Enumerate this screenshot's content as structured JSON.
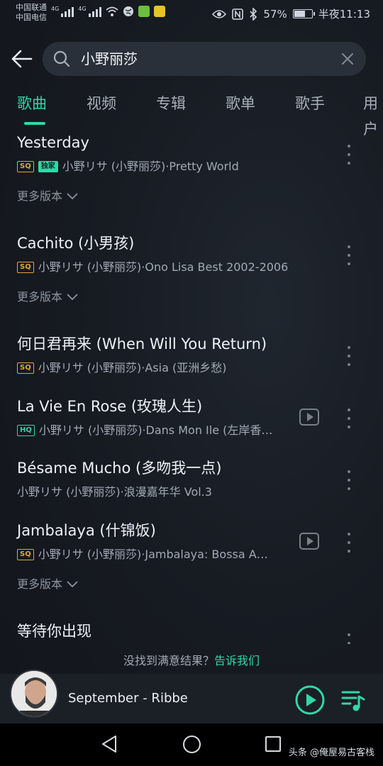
{
  "status_bar": {
    "carrier_1": "中国联通",
    "carrier_2": "中国电信",
    "net_1": "4G",
    "net_2": "4G",
    "battery": "57%",
    "battery_level": 0.57,
    "time": "半夜11:13"
  },
  "search": {
    "query": "小野丽莎"
  },
  "tabs": [
    {
      "label": "歌曲",
      "active": true
    },
    {
      "label": "视频"
    },
    {
      "label": "专辑"
    },
    {
      "label": "歌单"
    },
    {
      "label": "歌手"
    },
    {
      "label": "用户"
    }
  ],
  "songs": [
    {
      "title": "Yesterday",
      "badges": [
        "SQ",
        "独家"
      ],
      "meta": "小野リサ (小野丽莎)·Pretty World",
      "more_versions": "更多版本"
    },
    {
      "title": "Cachito (小男孩)",
      "badges": [
        "SQ"
      ],
      "meta": "小野リサ (小野丽莎)·Ono Lisa Best 2002-2006",
      "more_versions": "更多版本"
    },
    {
      "title": "何日君再来 (When Will You Return)",
      "badges": [
        "SQ"
      ],
      "meta": "小野リサ (小野丽莎)·Asia (亚洲乡愁)"
    },
    {
      "title": "La Vie En Rose (玫瑰人生)",
      "badges": [
        "HQ"
      ],
      "meta": "小野リサ (小野丽莎)·Dans Mon Ile (左岸香…",
      "has_video": true
    },
    {
      "title": "Bésame Mucho (多吻我一点)",
      "badges": [],
      "meta": "小野リサ (小野丽莎)·浪漫嘉年华 Vol.3"
    },
    {
      "title": "Jambalaya (什锦饭)",
      "badges": [
        "SQ"
      ],
      "meta": "小野リサ (小野丽莎)·Jambalaya: Bossa A…",
      "has_video": true,
      "more_versions": "更多版本"
    },
    {
      "title": "等待你出现",
      "badges": [],
      "meta": ""
    }
  ],
  "feedback": {
    "text": "没找到满意结果？",
    "link": "告诉我们"
  },
  "player": {
    "now_playing": "September - Ribbe"
  },
  "watermark": "头条 @俺屋易古客栈",
  "colors": {
    "accent": "#2fd8a4",
    "sq_badge": "#e0a63a",
    "background": "#171b22"
  }
}
